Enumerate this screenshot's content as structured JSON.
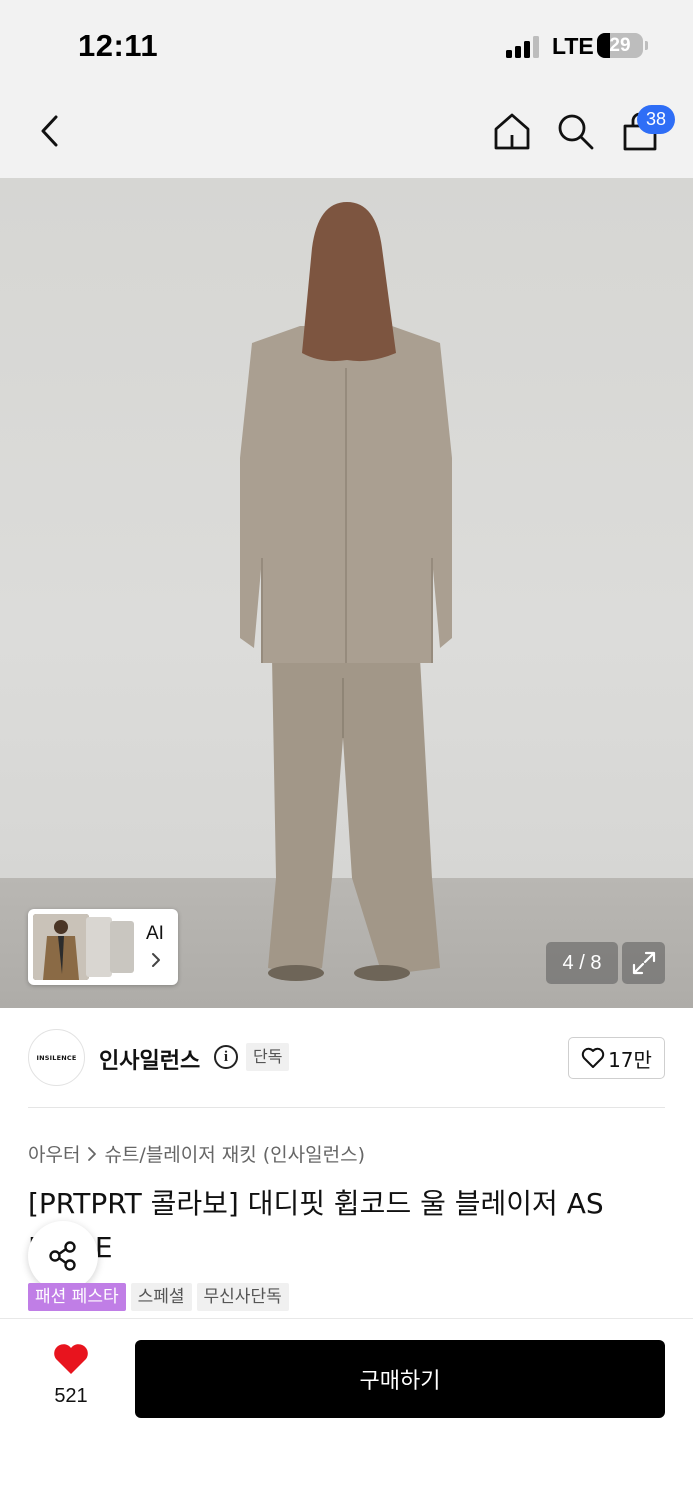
{
  "status_bar": {
    "time": "12:11",
    "network": "LTE",
    "battery": "29",
    "battery_level": 0.29
  },
  "nav": {
    "cart_count": "38"
  },
  "gallery": {
    "counter": "4 / 8",
    "ai_label": "AI"
  },
  "brand": {
    "logo_text": "INSILENCE",
    "name": "인사일런스",
    "info_glyph": "i",
    "exclusive_tag": "단독",
    "like_count": "17만"
  },
  "product": {
    "breadcrumb": [
      "아우터",
      "슈트/블레이저 재킷 (인사일런스)"
    ],
    "title": "[PRTPRT 콜라보] 대디핏 휩코드 울 블레이저 AS BEIGE",
    "tags": [
      "패션 페스타",
      "스페셜",
      "무신사단독"
    ]
  },
  "bottom_bar": {
    "wish_count": "521",
    "buy_label": "구매하기"
  },
  "colors": {
    "badge": "#2f6ef6",
    "festa_tag": "#c07ee6",
    "wish_heart": "#e8141e",
    "buy_button": "#000000"
  }
}
